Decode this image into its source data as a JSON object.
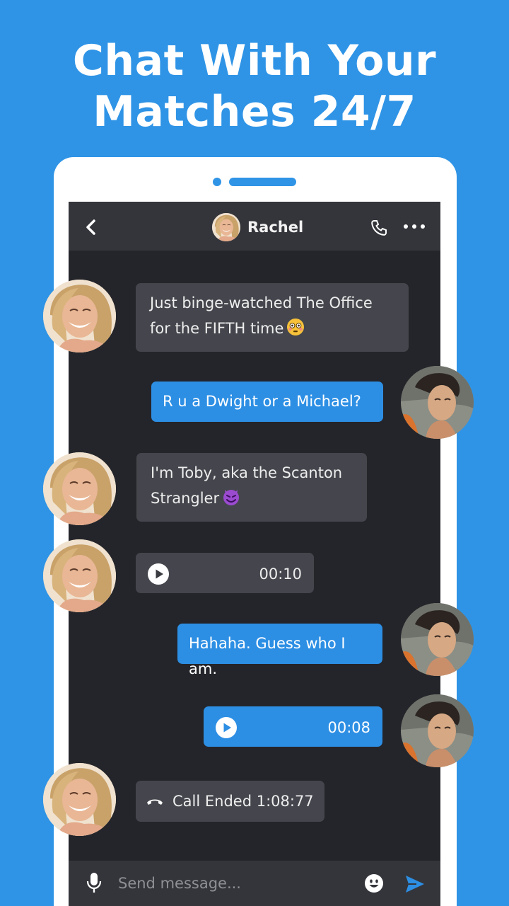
{
  "headline": {
    "line1": "Chat With Your",
    "line2": "Matches 24/7"
  },
  "header": {
    "contact_name": "Rachel",
    "back_icon": "chevron-left-icon",
    "call_icon": "phone-icon",
    "more_icon": "more-dots-icon"
  },
  "messages": [
    {
      "from": "them",
      "type": "text",
      "text": "Just binge-watched The Office",
      "text2": "for the FIFTH time",
      "emoji": "flushed-face"
    },
    {
      "from": "me",
      "type": "text",
      "text": "R u a Dwight or a Michael?"
    },
    {
      "from": "them",
      "type": "text",
      "text": "I'm Toby, aka the Scanton",
      "text2": "Strangler",
      "emoji": "smiling-devil"
    },
    {
      "from": "them",
      "type": "voice",
      "duration": "00:10"
    },
    {
      "from": "me",
      "type": "text",
      "text": "Hahaha. Guess who I am."
    },
    {
      "from": "me",
      "type": "voice",
      "duration": "00:08"
    },
    {
      "from": "them",
      "type": "call",
      "text": "Call Ended 1:08:77"
    }
  ],
  "composer": {
    "placeholder": "Send message...",
    "mic_icon": "microphone-icon",
    "emoji_icon": "smiley-icon",
    "send_icon": "send-icon"
  },
  "colors": {
    "background": "#2f94e6",
    "screen": "#24252a",
    "incoming_bubble": "#45464d",
    "outgoing_bubble": "#2d8fe4"
  }
}
